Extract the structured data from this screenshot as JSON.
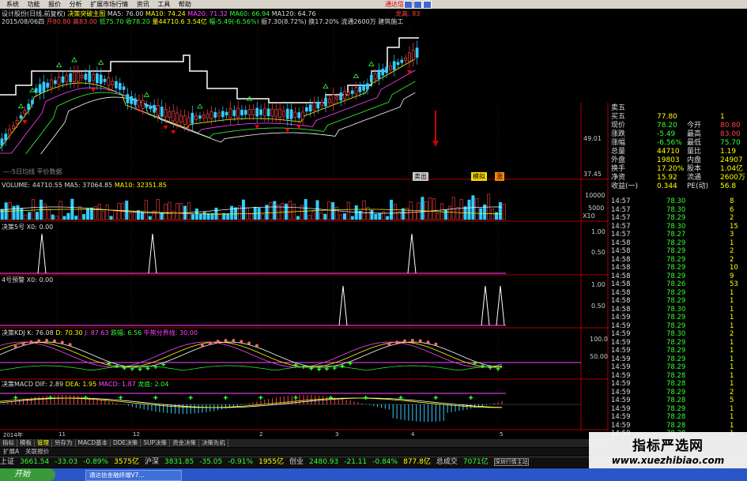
{
  "menu": [
    "系统",
    "功能",
    "报价",
    "分析",
    "扩展市场行情",
    "资讯",
    "工具",
    "帮助"
  ],
  "brand": "通达信金融",
  "main_header": {
    "title": "决策突破主图",
    "ma5": "MA5: 76.00",
    "ma10": "MA10: 74.24",
    "ma20": "MA20: 71.32",
    "ma60": "MA60: 66.94",
    "ma120": "MA120: 64.76",
    "right_tag": "龙高: 83",
    "left_name": "设计股份(日线,前复权)"
  },
  "info_line": {
    "date": "2015/08/06四",
    "open": "开80.80",
    "high": "高83.00",
    "low": "低75.70",
    "close": "收78.20",
    "vol": "量44710.6",
    "amt": "3.54亿",
    "chg": "幅-5.49(-6.56%)",
    "amp": "振7.30(8.72%)",
    "turn": "换17.20%",
    "float": "流通2600万",
    "industry": "建筑施工"
  },
  "price_axis": [
    "49.01",
    "37.45"
  ],
  "main_footer": {
    "left": "—-5日均线  平价数据",
    "mark1": "卖出",
    "mark2": "模拟",
    "mark3": "涨"
  },
  "volume": {
    "label": "VOLUME: 44710.55",
    "ma5": "MA5: 37064.85",
    "ma10": "MA10: 32351.85",
    "axis": [
      "10000",
      "5000",
      "X10"
    ]
  },
  "ind5": {
    "label": "决策5号  X0: 0.00",
    "axis": [
      "1.00",
      "0.50"
    ]
  },
  "ind4": {
    "label": "4号预警  X0: 0.00",
    "axis": [
      "1.00",
      "0.50"
    ]
  },
  "kdj": {
    "label": "决策KDJ  K: 76.08",
    "d": "D: 70.30",
    "j": "J: 87.63",
    "dip": "跌幅: 6.56",
    "line": "牛熊分界线: 30.00",
    "axis": [
      "100.0",
      "50.00"
    ]
  },
  "macd": {
    "label": "决策MACD  DIF: 2.89",
    "dea": "DEA: 1.95",
    "macd": "MACD: 1.87",
    "lh": "龙底: 2.04"
  },
  "date_ticks": [
    "2014年",
    "11",
    "12",
    "2",
    "3",
    "4",
    "5"
  ],
  "bottom_tabs": [
    "指标",
    "模板",
    "管理",
    "另存为",
    "MACD基本",
    "DDE决策",
    "SUP决策",
    "资金决策",
    "决策先机"
  ],
  "bottom_tabs2": [
    "扩展A",
    "关联报价"
  ],
  "quote": {
    "rows": [
      {
        "k1": "卖五",
        "v1": "",
        "k2": "",
        "v2": ""
      },
      {
        "k1": "买五",
        "v1": "77.80",
        "k2": "",
        "v2": "1"
      },
      {
        "k1": "现价",
        "v1": "78.20",
        "k2": "今开",
        "v2": "80.80"
      },
      {
        "k1": "涨跌",
        "v1": "-5.49",
        "k2": "最高",
        "v2": "83.00"
      },
      {
        "k1": "涨幅",
        "v1": "-6.56%",
        "k2": "最低",
        "v2": "75.70"
      },
      {
        "k1": "总量",
        "v1": "44710",
        "k2": "量比",
        "v2": "1.19"
      },
      {
        "k1": "外盘",
        "v1": "19803",
        "k2": "内盘",
        "v2": "24907"
      },
      {
        "k1": "换手",
        "v1": "17.20%",
        "k2": "股本",
        "v2": "1.04亿"
      },
      {
        "k1": "净资",
        "v1": "15.92",
        "k2": "流通",
        "v2": "2600万"
      },
      {
        "k1": "收益(一)",
        "v1": "0.344",
        "k2": "PE(动)",
        "v2": "56.8"
      }
    ]
  },
  "trades": [
    {
      "t": "14:57",
      "p": "78.30",
      "v": "8"
    },
    {
      "t": "14:57",
      "p": "78.30",
      "v": "6"
    },
    {
      "t": "14:57",
      "p": "78.29",
      "v": "2"
    },
    {
      "t": "14:57",
      "p": "78.30",
      "v": "15"
    },
    {
      "t": "14:57",
      "p": "78.27",
      "v": "3"
    },
    {
      "t": "14:58",
      "p": "78.29",
      "v": "1"
    },
    {
      "t": "14:58",
      "p": "78.29",
      "v": "2"
    },
    {
      "t": "14:58",
      "p": "78.29",
      "v": "2"
    },
    {
      "t": "14:58",
      "p": "78.29",
      "v": "10"
    },
    {
      "t": "14:58",
      "p": "78.29",
      "v": "9"
    },
    {
      "t": "14:58",
      "p": "78.26",
      "v": "53"
    },
    {
      "t": "14:58",
      "p": "78.29",
      "v": "1"
    },
    {
      "t": "14:58",
      "p": "78.29",
      "v": "1"
    },
    {
      "t": "14:58",
      "p": "78.30",
      "v": "1"
    },
    {
      "t": "14:59",
      "p": "78.29",
      "v": "1"
    },
    {
      "t": "14:59",
      "p": "78.29",
      "v": "1"
    },
    {
      "t": "14:59",
      "p": "78.30",
      "v": "2"
    },
    {
      "t": "14:59",
      "p": "78.29",
      "v": "1"
    },
    {
      "t": "14:59",
      "p": "78.29",
      "v": "1"
    },
    {
      "t": "14:59",
      "p": "78.29",
      "v": "1"
    },
    {
      "t": "14:59",
      "p": "78.29",
      "v": "1"
    },
    {
      "t": "14:59",
      "p": "78.28",
      "v": "1"
    },
    {
      "t": "14:59",
      "p": "78.28",
      "v": "1"
    },
    {
      "t": "14:59",
      "p": "78.29",
      "v": "2"
    },
    {
      "t": "14:59",
      "p": "78.28",
      "v": "5"
    },
    {
      "t": "14:59",
      "p": "78.29",
      "v": "1"
    },
    {
      "t": "14:59",
      "p": "78.28",
      "v": "1"
    },
    {
      "t": "14:59",
      "p": "78.28",
      "v": "1"
    },
    {
      "t": "14:59",
      "p": "78.28",
      "v": "1"
    }
  ],
  "index_bar": [
    {
      "name": "上证",
      "val": "3661.54",
      "chg": "-33.03",
      "pct": "-0.89%",
      "amt": "3575亿"
    },
    {
      "name": "沪深",
      "val": "3831.85",
      "chg": "-35.05",
      "pct": "-0.91%",
      "amt": "1955亿"
    },
    {
      "name": "创业",
      "val": "2480.93",
      "chg": "-21.11",
      "pct": "-0.84%",
      "amt": "877.8亿"
    },
    {
      "name": "总成交",
      "val": "7071亿",
      "chg": "",
      "pct": "",
      "amt": ""
    }
  ],
  "status_right": "深圳行情主站",
  "taskbar": {
    "start": "开始",
    "item": "通达信金融终端V7..."
  },
  "watermark": {
    "line1": "指标严选网",
    "line2": "www.xuezhibiao.com"
  }
}
